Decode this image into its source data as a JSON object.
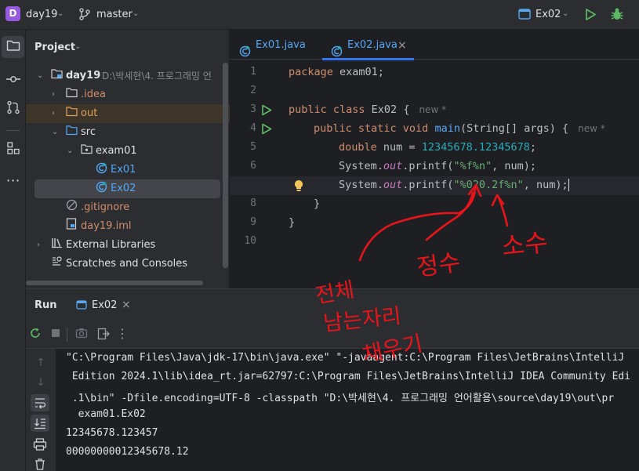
{
  "titlebar": {
    "project_badge": "D",
    "project_name": "day19",
    "branch": "master",
    "run_config": "Ex02",
    "colors": {
      "badge": "#955ae0",
      "run": "#5fb865",
      "debug": "#5fb865"
    }
  },
  "project_panel": {
    "title": "Project",
    "tree": [
      {
        "label": "day19",
        "detail": "D:\\박세현\\4. 프로그래밍 언",
        "type": "module",
        "expanded": true
      },
      {
        "label": ".idea",
        "type": "folder",
        "expanded": false
      },
      {
        "label": "out",
        "type": "folder-excluded",
        "expanded": false
      },
      {
        "label": "src",
        "type": "folder-source",
        "expanded": true
      },
      {
        "label": "exam01",
        "type": "package",
        "expanded": true
      },
      {
        "label": "Ex01",
        "type": "class"
      },
      {
        "label": "Ex02",
        "type": "class",
        "selected": true
      },
      {
        "label": ".gitignore",
        "type": "file-ignore"
      },
      {
        "label": "day19.iml",
        "type": "file-iml"
      },
      {
        "label": "External Libraries",
        "type": "libraries",
        "expanded": false
      },
      {
        "label": "Scratches and Consoles",
        "type": "scratches"
      }
    ]
  },
  "editor": {
    "tabs": [
      {
        "label": "Ex01.java",
        "active": false
      },
      {
        "label": "Ex02.java",
        "active": true
      }
    ],
    "close_glyph": "×",
    "line_numbers": [
      "1",
      "2",
      "3",
      "4",
      "5",
      "6",
      "7",
      "8",
      "9",
      "10"
    ],
    "hints": {
      "new": "new *"
    },
    "code": {
      "l1_kw": "package",
      "l1_rest": " exam01;",
      "l3_kw": "public class",
      "l3_name": " Ex02 {",
      "l4_kw": "public static void",
      "l4_fn": "main",
      "l4_rest": "(String[] args) {",
      "l5_kw": "double",
      "l5_mid": " num = ",
      "l5_num": "12345678.12345678",
      "l5_end": ";",
      "l6_a": "System.",
      "l6_out": "out",
      "l6_b": ".printf(",
      "l6_str": "\"%f%n\"",
      "l6_c": ", num);",
      "l7_a": "System.",
      "l7_out": "out",
      "l7_b": ".printf(",
      "l7_str": "\"%020.2f%n\"",
      "l7_c": ", num);",
      "l8": "}",
      "l9": "}"
    }
  },
  "run_panel": {
    "title": "Run",
    "tab_label": "Ex02",
    "console": [
      "\"C:\\Program Files\\Java\\jdk-17\\bin\\java.exe\" \"-javaagent:C:\\Program Files\\JetBrains\\IntelliJ",
      " Edition 2024.1\\lib\\idea_rt.jar=62797:C:\\Program Files\\JetBrains\\IntelliJ IDEA Community Edi",
      " .1\\bin\" -Dfile.encoding=UTF-8 -classpath \"D:\\박세현\\4. 프로그래밍 언어활용\\source\\day19\\out\\pr",
      "  exam01.Ex02",
      "12345678.123457",
      "00000000012345678.12"
    ]
  },
  "annotations": {
    "color": "#e8141b",
    "labels": [
      "정수",
      "소수",
      "전체",
      "남는자리",
      "채우기"
    ]
  }
}
